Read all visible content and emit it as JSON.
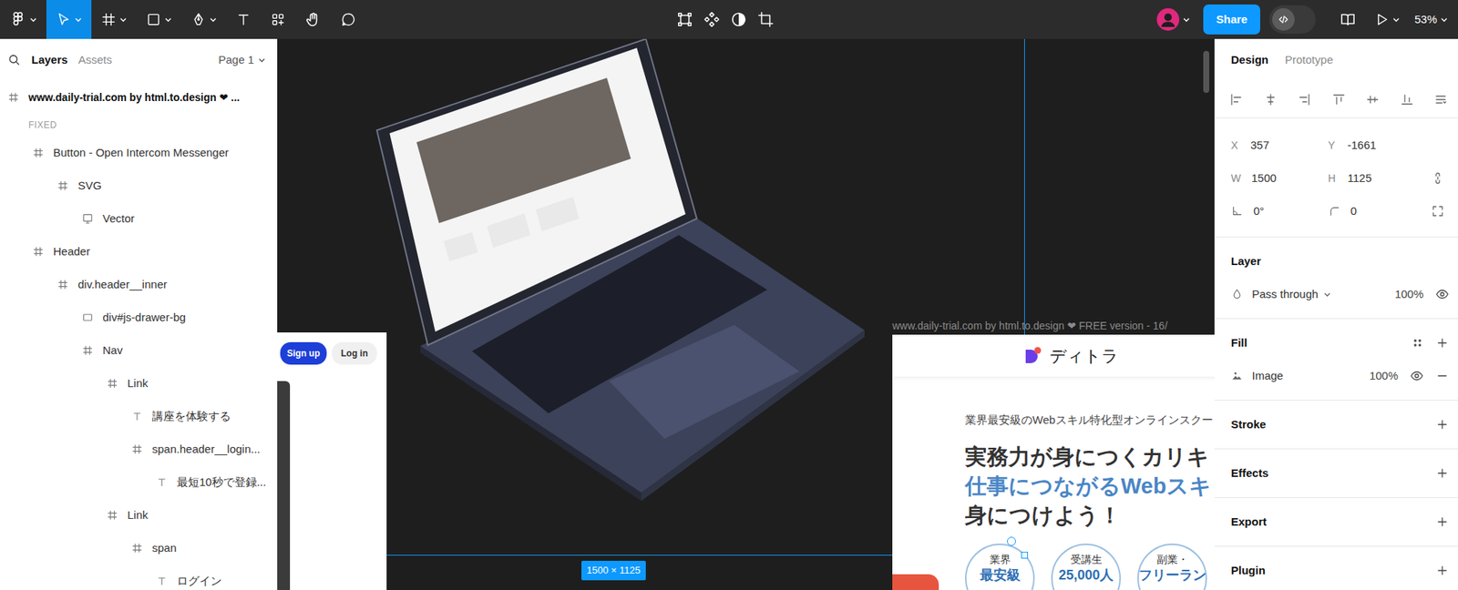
{
  "toolbar": {
    "tools": [
      {
        "selected": false
      },
      {
        "selected": true
      },
      {
        "selected": false
      },
      {
        "selected": false
      },
      {
        "selected": false
      },
      {
        "selected": false
      },
      {
        "selected": false
      },
      {
        "selected": false
      },
      {
        "selected": false
      }
    ],
    "share": "Share",
    "zoom": "53%"
  },
  "layers_panel": {
    "tabs": [
      {
        "label": "Layers",
        "selected": true
      },
      {
        "label": "Assets",
        "selected": false
      }
    ],
    "page": "Page 1",
    "root": "www.daily-trial.com by html.to.design ❤ ...",
    "section": "FIXED",
    "items": [
      {
        "label": "Button - Open Intercom Messenger",
        "depth": 1,
        "kind": "frame"
      },
      {
        "label": "SVG",
        "depth": 2,
        "kind": "frame"
      },
      {
        "label": "Vector",
        "depth": 3,
        "kind": "vector"
      },
      {
        "label": "Header",
        "depth": 1,
        "kind": "frame"
      },
      {
        "label": "div.header__inner",
        "depth": 2,
        "kind": "frame"
      },
      {
        "label": "div#js-drawer-bg",
        "depth": 3,
        "kind": "rect"
      },
      {
        "label": "Nav",
        "depth": 3,
        "kind": "frame"
      },
      {
        "label": "Link",
        "depth": 4,
        "kind": "frame"
      },
      {
        "label": "講座を体験する",
        "depth": 5,
        "kind": "text"
      },
      {
        "label": "span.header__login...",
        "depth": 5,
        "kind": "frame"
      },
      {
        "label": "最短10秒で登録...",
        "depth": 6,
        "kind": "text"
      },
      {
        "label": "Link",
        "depth": 4,
        "kind": "frame"
      },
      {
        "label": "span",
        "depth": 5,
        "kind": "frame"
      },
      {
        "label": "ログイン",
        "depth": 6,
        "kind": "text"
      }
    ]
  },
  "canvas": {
    "left_frame": {
      "buttons": [
        "Sign up",
        "Log in"
      ]
    },
    "selection_size": "1500 × 1125",
    "right_frame": {
      "label": "www.daily-trial.com by html.to.design ❤ FREE version - 16/",
      "logo": "ディトラ",
      "tagline": "業界最安級のWebスキル特化型オンラインスクー",
      "headline": [
        {
          "text": "実務力が身につくカリキ",
          "accent": false
        },
        {
          "text": "仕事につながるWebスキ",
          "accent": true
        },
        {
          "text": "身につけよう！",
          "accent": false
        }
      ],
      "badges": [
        {
          "lines": [
            "業界",
            "最安級"
          ]
        },
        {
          "lines": [
            "受講生",
            "25,000人"
          ]
        },
        {
          "lines": [
            "副業・",
            "フリーラン"
          ]
        }
      ]
    }
  },
  "design_panel": {
    "tabs": [
      {
        "label": "Design",
        "selected": true
      },
      {
        "label": "Prototype",
        "selected": false
      }
    ],
    "fields": [
      {
        "label": "X",
        "value": "357"
      },
      {
        "label": "Y",
        "value": "-1661"
      },
      {
        "label": "W",
        "value": "1500"
      },
      {
        "label": "H",
        "value": "1125"
      }
    ],
    "rotation": "0°",
    "radius": "0",
    "layer": {
      "title": "Layer",
      "blend": "Pass through",
      "opacity": "100%",
      "visible": true
    },
    "fill": {
      "title": "Fill",
      "type": "Image",
      "opacity": "100%",
      "visible": true
    },
    "sections": [
      "Stroke",
      "Effects",
      "Export",
      "Plugin"
    ]
  }
}
